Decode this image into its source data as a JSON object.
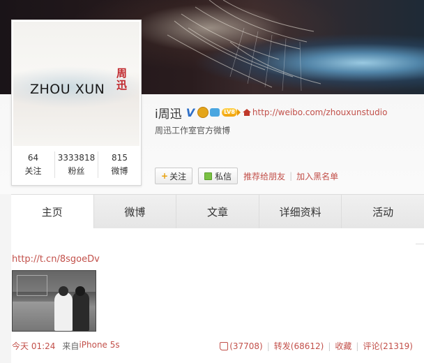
{
  "profile": {
    "avatar_logo": "ZHOU XUN",
    "avatar_chop": "周迅",
    "name": "i周迅",
    "verified_badge": "V",
    "level_badge": "LV8",
    "homepage_url": "http://weibo.com/zhouxunstudio",
    "intro": "周迅工作室官方微博",
    "stats": [
      {
        "value": "64",
        "label": "关注"
      },
      {
        "value": "3333818",
        "label": "粉丝"
      },
      {
        "value": "815",
        "label": "微博"
      }
    ]
  },
  "actions": {
    "follow": "关注",
    "message": "私信",
    "recommend": "推荐给朋友",
    "blacklist": "加入黑名单"
  },
  "tabs": [
    {
      "label": "主页"
    },
    {
      "label": "微博"
    },
    {
      "label": "文章"
    },
    {
      "label": "详细资料"
    },
    {
      "label": "活动"
    }
  ],
  "post": {
    "short_url": "http://t.cn/8sgoeDv",
    "time": "今天 01:24",
    "from_prefix": "来自",
    "source": "iPhone 5s",
    "likes": "(37708)",
    "repost": "转发(68612)",
    "favorite": "收藏",
    "comment": "评论(21319)"
  },
  "colors": {
    "link": "#c2504a",
    "verified": "#2f6fc6",
    "level_badge": "#f1a10a"
  }
}
